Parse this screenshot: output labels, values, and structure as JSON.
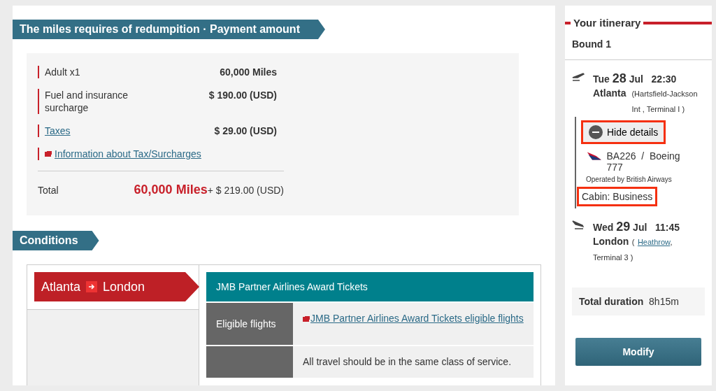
{
  "payment": {
    "title": "The miles requires of redumpition · Payment amount",
    "lines": [
      {
        "kind": "text",
        "label": "Adult x1",
        "value": "60,000 Miles"
      },
      {
        "kind": "text",
        "label": "Fuel and insurance surcharge",
        "value": "$ 190.00 (USD)"
      },
      {
        "kind": "link",
        "label": "Taxes",
        "value": "$ 29.00 (USD)"
      },
      {
        "kind": "info",
        "label": "Information about Tax/Surcharges"
      }
    ],
    "total": {
      "label": "Total",
      "miles": "60,000 Miles",
      "amount": "+ $ 219.00 (USD)"
    }
  },
  "conditions": {
    "title": "Conditions",
    "route": {
      "from": "Atlanta",
      "to": "London"
    },
    "award": "JMB Partner Airlines Award Tickets",
    "rows": [
      {
        "label": "Eligible flights",
        "link": "JMB Partner Airlines Award Tickets eligible flights"
      },
      {
        "label": "",
        "text": "All travel should be in the same class of service."
      }
    ]
  },
  "itinerary": {
    "title": "Your itinerary",
    "bound": "Bound 1",
    "departure": {
      "dow": "Tue",
      "day": "28",
      "month": "Jul",
      "time": "22:30",
      "city": "Atlanta",
      "airport": "(Hartsfield-Jackson Int ,  Terminal I )"
    },
    "hide_details": {
      "label": "Hide details",
      "highlighted": true
    },
    "flight": {
      "number": "BA226  /  Boeing 777",
      "operator": "Operated by British Airways"
    },
    "cabin": {
      "label": "Cabin: Business",
      "highlighted": true
    },
    "arrival": {
      "dow": "Wed",
      "day": "29",
      "month": "Jul",
      "time": "11:45",
      "city": "London",
      "airport_pre": "(",
      "airport_link": "Heathrow",
      "airport_post": ",",
      "terminal": "Terminal 3 )"
    },
    "duration_label": "Total duration",
    "duration": "8h15m",
    "button": "Modify"
  }
}
